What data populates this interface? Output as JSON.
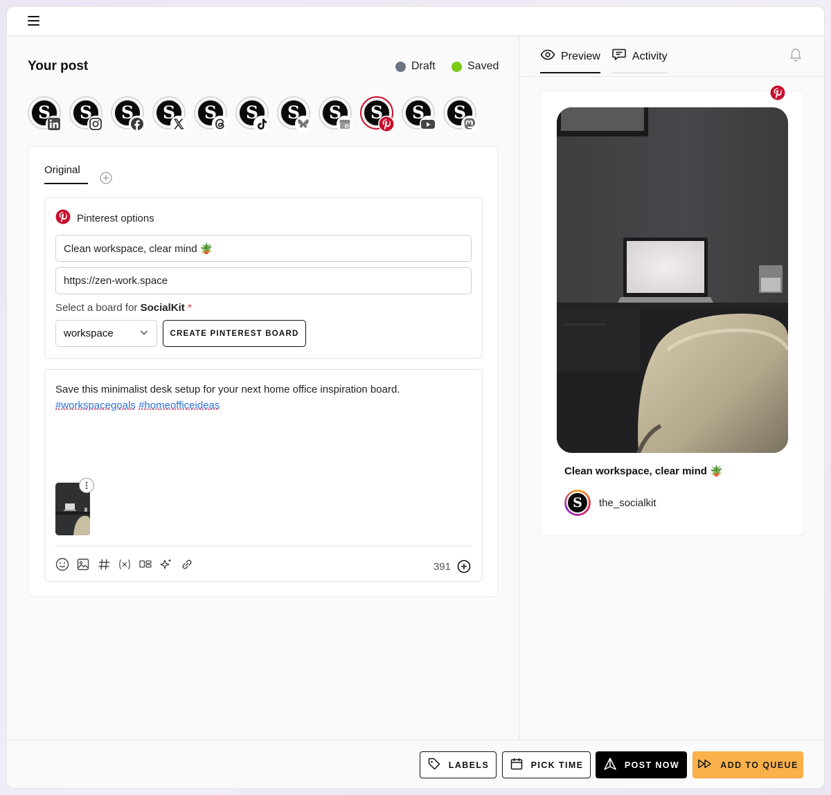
{
  "header": {
    "menu_icon": "hamburger-icon"
  },
  "editor": {
    "title": "Your post",
    "status": [
      {
        "label": "Draft",
        "color": "#6b7280"
      },
      {
        "label": "Saved",
        "color": "#7acb14"
      }
    ],
    "accounts": [
      {
        "network": "LinkedIn",
        "badge_icon": "linkedin-icon"
      },
      {
        "network": "Instagram",
        "badge_icon": "instagram-icon"
      },
      {
        "network": "Facebook",
        "badge_icon": "facebook-icon"
      },
      {
        "network": "X",
        "badge_icon": "x-icon"
      },
      {
        "network": "Threads",
        "badge_icon": "threads-icon"
      },
      {
        "network": "TikTok",
        "badge_icon": "tiktok-icon"
      },
      {
        "network": "Bluesky",
        "badge_icon": "bluesky-icon"
      },
      {
        "network": "Google Business",
        "badge_icon": "google-business-icon"
      },
      {
        "network": "Pinterest",
        "badge_icon": "pinterest-icon",
        "selected": true
      },
      {
        "network": "YouTube",
        "badge_icon": "youtube-icon"
      },
      {
        "network": "Mastodon",
        "badge_icon": "mastodon-icon"
      }
    ],
    "tabs": {
      "original": "Original"
    },
    "pinterest": {
      "heading": "Pinterest options",
      "title_value": "Clean workspace, clear mind 🪴",
      "link_value": "https://zen-work.space",
      "board_label_prefix": "Select a board for ",
      "board_label_account": "SocialKit",
      "board_label_required": "*",
      "board_selected": "workspace",
      "create_board_label": "CREATE PINTEREST BOARD"
    },
    "post": {
      "text": "Save this minimalist desk setup for your next home office inspiration board.",
      "hashtags": [
        "#workspacegoals",
        "#homeofficeideas"
      ],
      "char_count": "391"
    },
    "toolbar_icons": [
      "emoji-icon",
      "image-icon",
      "hashtag-icon",
      "variable-icon",
      "layout-icon",
      "ai-sparkle-icon",
      "link-icon"
    ]
  },
  "preview": {
    "tabs": {
      "preview": "Preview",
      "activity": "Activity"
    },
    "pin_title": "Clean workspace, clear mind 🪴",
    "username": "the_socialkit"
  },
  "actions": {
    "labels": "LABELS",
    "pick_time": "PICK TIME",
    "post_now": "POST NOW",
    "add_to_queue": "ADD TO QUEUE"
  },
  "colors": {
    "accent_orange": "#fbb14b",
    "pinterest_red": "#c8102e",
    "hashtag_blue": "#2f6fd6"
  }
}
